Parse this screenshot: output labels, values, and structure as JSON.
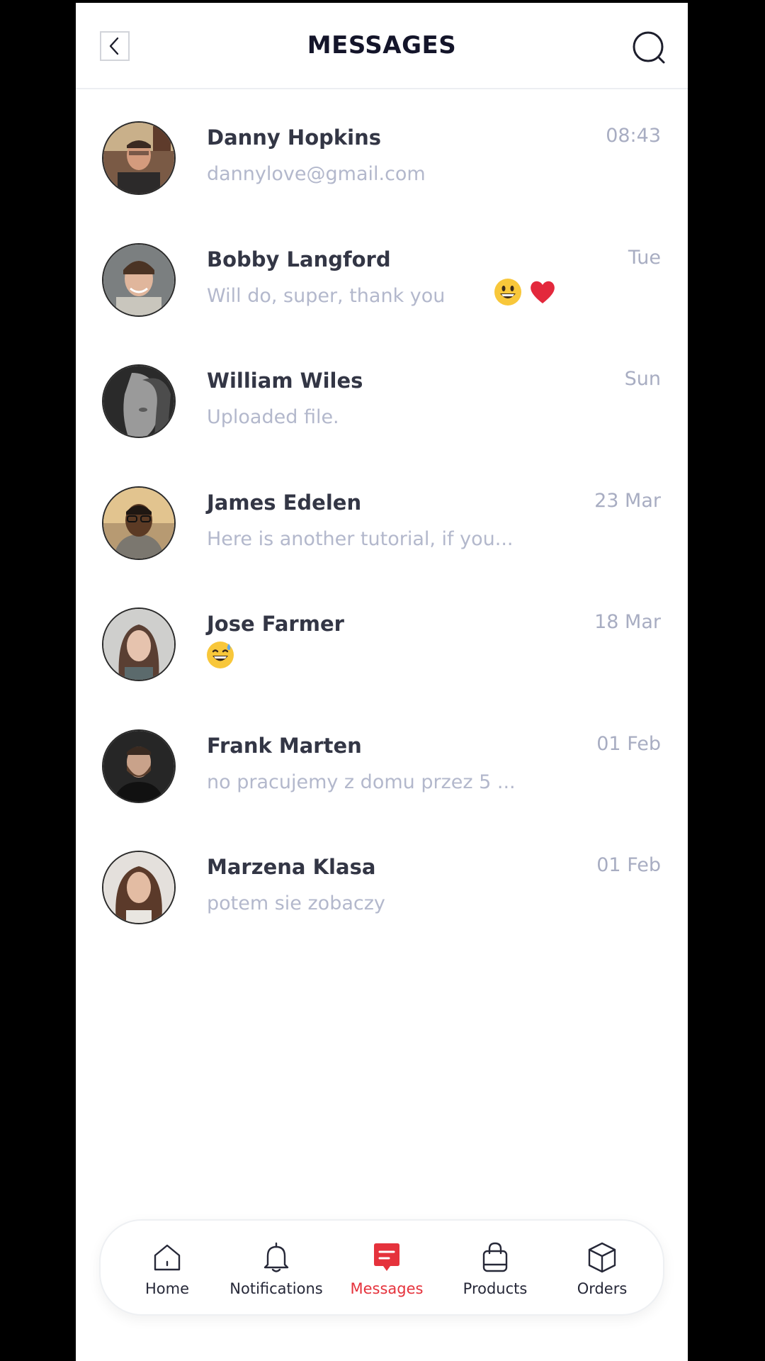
{
  "header": {
    "title": "MESSAGES"
  },
  "conversations": [
    {
      "name": "Danny Hopkins",
      "time": "08:43",
      "preview": "dannylove@gmail.com"
    },
    {
      "name": "Bobby Langford",
      "time": "Tue",
      "preview": "Will do, super, thank you",
      "emojis": [
        "grinning-face",
        "red-heart"
      ]
    },
    {
      "name": "William Wiles",
      "time": "Sun",
      "preview": "Uploaded file."
    },
    {
      "name": "James Edelen",
      "time": "23 Mar",
      "preview": "Here is another tutorial, if you..."
    },
    {
      "name": "Jose Farmer",
      "time": "18 Mar",
      "preview": "",
      "emojis": [
        "grinning-face-with-sweat"
      ]
    },
    {
      "name": "Frank Marten",
      "time": "01 Feb",
      "preview": "no pracujemy z domu przez 5 ..."
    },
    {
      "name": "Marzena Klasa",
      "time": "01 Feb",
      "preview": "potem sie zobaczy"
    }
  ],
  "tabbar": {
    "tabs": [
      {
        "label": "Home",
        "icon": "home-icon"
      },
      {
        "label": "Notifications",
        "icon": "bell-icon"
      },
      {
        "label": "Messages",
        "icon": "chat-icon",
        "active": true
      },
      {
        "label": "Products",
        "icon": "bag-icon"
      },
      {
        "label": "Orders",
        "icon": "box-icon"
      }
    ]
  },
  "colors": {
    "accent": "#e5323c",
    "title": "#14152a",
    "name": "#333645",
    "muted": "#b3b8cc"
  }
}
